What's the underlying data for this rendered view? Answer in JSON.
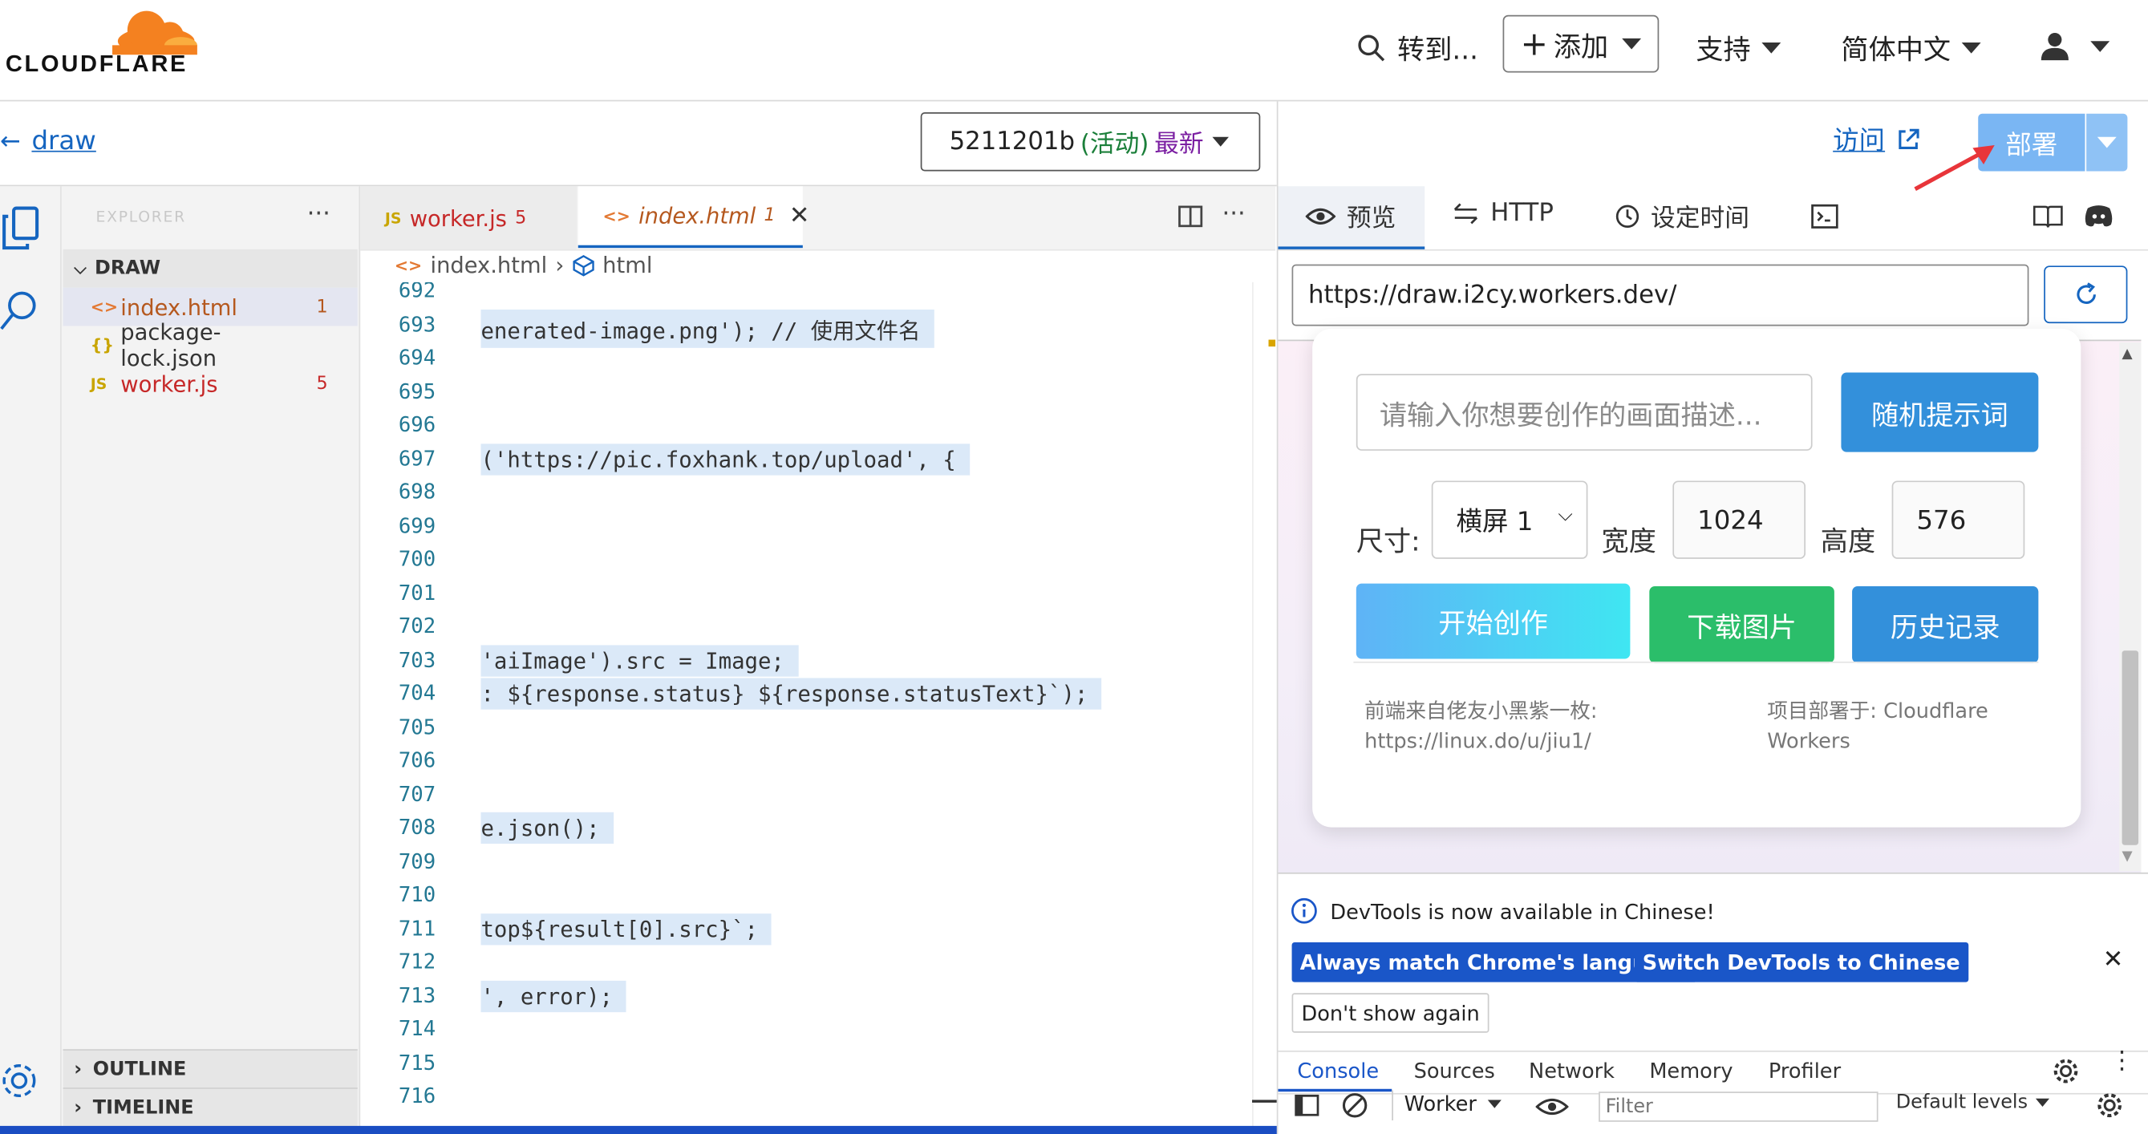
{
  "header": {
    "brand": "CLOUDFLARE",
    "search_label": "转到...",
    "add_label": "添加",
    "support_label": "支持",
    "language_label": "简体中文"
  },
  "subbar": {
    "back_label": "draw",
    "version_id": "5211201b",
    "version_status": "(活动)",
    "version_latest": "最新"
  },
  "explorer": {
    "title": "EXPLORER",
    "section": "DRAW",
    "files": [
      {
        "icon": "<>",
        "name": "index.html",
        "badge": "1"
      },
      {
        "icon": "{}",
        "name": "package-lock.json",
        "badge": ""
      },
      {
        "icon": "JS",
        "name": "worker.js",
        "badge": "5"
      }
    ],
    "outline": "OUTLINE",
    "timeline": "TIMELINE"
  },
  "editor": {
    "tabs": [
      {
        "icon": "JS",
        "name": "worker.js",
        "badge": "5"
      },
      {
        "icon": "<>",
        "name": "index.html",
        "badge": "1"
      }
    ],
    "breadcrumb": [
      "index.html",
      "html"
    ],
    "line_numbers": [
      "692",
      "693",
      "694",
      "695",
      "696",
      "697",
      "698",
      "699",
      "700",
      "701",
      "702",
      "703",
      "704",
      "705",
      "706",
      "707",
      "708",
      "709",
      "710",
      "711",
      "712",
      "713",
      "714",
      "715",
      "716"
    ],
    "code_lines": [
      {
        "line": "693",
        "text": "enerated-image.png'); // 使用文件名"
      },
      {
        "line": "697",
        "text": "('https://pic.foxhank.top/upload', {"
      },
      {
        "line": "703",
        "text": "'aiImage').src = Image;"
      },
      {
        "line": "704",
        "text": ": ${response.status} ${response.statusText}`);"
      },
      {
        "line": "708",
        "text": "e.json();"
      },
      {
        "line": "711",
        "text": "top${result[0].src}`;"
      },
      {
        "line": "713",
        "text": "', error);"
      }
    ]
  },
  "right_panel": {
    "visit_label": "访问",
    "deploy_label": "部署",
    "tabs": [
      "预览",
      "HTTP",
      "设定时间"
    ],
    "url": "https://draw.i2cy.workers.dev/"
  },
  "preview_app": {
    "prompt_placeholder": "请输入你想要创作的画面描述...",
    "random_prompt_label": "随机提示词",
    "size_label": "尺寸:",
    "size_value": "横屏 1",
    "width_label": "宽度",
    "width_value": "1024",
    "height_label": "高度",
    "height_value": "576",
    "start_label": "开始创作",
    "download_label": "下载图片",
    "history_label": "历史记录",
    "footer_left_1": "前端来自佬友小黑紫一枚:",
    "footer_left_2": "https://linux.do/u/jiu1/",
    "footer_right_1": "项目部署于: Cloudflare",
    "footer_right_2": "Workers"
  },
  "devtools": {
    "notice": "DevTools is now available in Chinese!",
    "match_label": "Always match Chrome's language",
    "switch_label": "Switch DevTools to Chinese",
    "dont_show_label": "Don't show again",
    "tabs": [
      "Console",
      "Sources",
      "Network",
      "Memory",
      "Profiler"
    ],
    "context": "Worker",
    "filter_placeholder": "Filter",
    "levels": "Default levels"
  },
  "colors": {
    "accent_blue": "#1565c0",
    "cloudflare_orange": "#f48120",
    "preview_blue": "#3390db",
    "preview_green": "#2bbe6a"
  }
}
